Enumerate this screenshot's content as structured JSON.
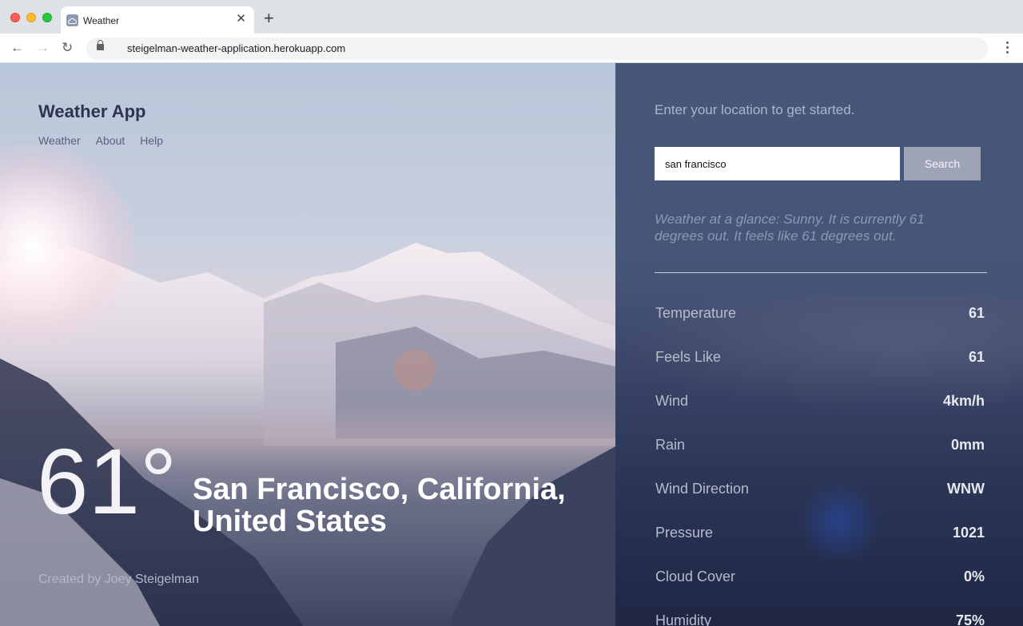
{
  "browser": {
    "tab_title": "Weather",
    "url": "steigelman-weather-application.herokuapp.com"
  },
  "app": {
    "title": "Weather App",
    "nav": [
      "Weather",
      "About",
      "Help"
    ],
    "temperature_display": "61°",
    "location": "San Francisco, California, United States",
    "created_by": "Created by Joey Steigelman"
  },
  "panel": {
    "prompt": "Enter your location to get started.",
    "search_value": "san francisco",
    "search_button": "Search",
    "glance": "Weather at a glance: Sunny. It is currently 61 degrees out. It feels like 61 degrees out.",
    "stats": [
      {
        "label": "Temperature",
        "value": "61"
      },
      {
        "label": "Feels Like",
        "value": "61"
      },
      {
        "label": "Wind",
        "value": "4km/h"
      },
      {
        "label": "Rain",
        "value": "0mm"
      },
      {
        "label": "Wind Direction",
        "value": "WNW"
      },
      {
        "label": "Pressure",
        "value": "1021"
      },
      {
        "label": "Cloud Cover",
        "value": "0%"
      },
      {
        "label": "Humidity",
        "value": "75%"
      }
    ]
  },
  "colors": {
    "panel_bg": "#3e4e70",
    "search_button_bg": "#9fa3b8",
    "title_color": "#2e3450"
  }
}
